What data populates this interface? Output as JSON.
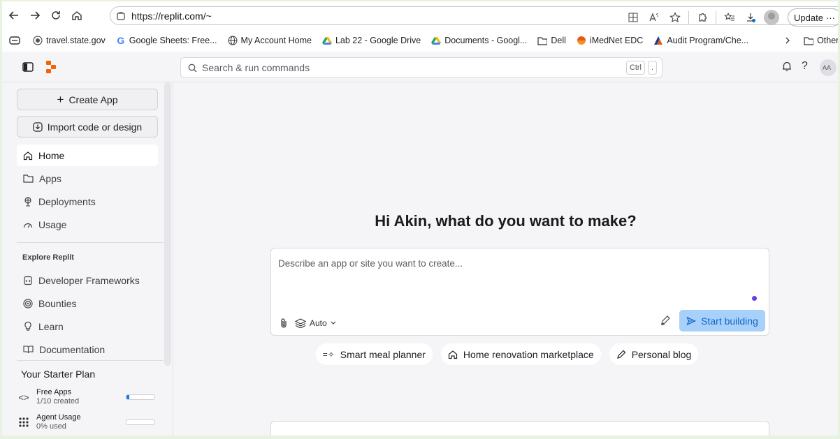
{
  "browser": {
    "url_prefix": "https://",
    "url_domain": "replit.com",
    "url_path": "/~",
    "update_label": "Update",
    "update_more": "···"
  },
  "bookmarks": [
    {
      "label": "travel.state.gov",
      "icon": "seal-icon"
    },
    {
      "label": "Google Sheets: Free...",
      "icon": "google-icon"
    },
    {
      "label": "My Account Home",
      "icon": "globe-icon"
    },
    {
      "label": "Lab 22 - Google Drive",
      "icon": "drive-icon"
    },
    {
      "label": "Documents - Googl...",
      "icon": "drive-icon"
    },
    {
      "label": "Dell",
      "icon": "folder-icon"
    },
    {
      "label": "iMedNet EDC",
      "icon": "imednet-icon"
    },
    {
      "label": "Audit Program/Che...",
      "icon": "audit-icon"
    }
  ],
  "bookmarks_other": "Other fa",
  "topbar": {
    "search_placeholder": "Search & run commands",
    "kbd1": "Ctrl",
    "kbd2": ".",
    "avatar": "AA"
  },
  "sidebar": {
    "create_app": "Create App",
    "import": "Import code or design",
    "nav": [
      {
        "label": "Home",
        "icon": "home-icon",
        "active": true
      },
      {
        "label": "Apps",
        "icon": "folder-icon",
        "active": false
      },
      {
        "label": "Deployments",
        "icon": "deploy-icon",
        "active": false
      },
      {
        "label": "Usage",
        "icon": "gauge-icon",
        "active": false
      }
    ],
    "explore_label": "Explore Replit",
    "explore": [
      {
        "label": "Developer Frameworks",
        "icon": "framework-icon"
      },
      {
        "label": "Bounties",
        "icon": "bounty-icon"
      },
      {
        "label": "Learn",
        "icon": "bulb-icon"
      },
      {
        "label": "Documentation",
        "icon": "book-icon"
      }
    ],
    "plan_label": "Your Starter Plan",
    "usage": [
      {
        "title": "Free Apps",
        "sub": "1/10 created",
        "fraction": 0.1
      },
      {
        "title": "Agent Usage",
        "sub": "0% used",
        "fraction": 0
      }
    ]
  },
  "main": {
    "greeting": "Hi Akin, what do you want to make?",
    "composer_placeholder": "Describe an app or site you want to create...",
    "mode": "Auto",
    "start_label": "Start building",
    "suggestions": [
      {
        "label": "Smart meal planner",
        "icon": "sparkle-icon"
      },
      {
        "label": "Home renovation marketplace",
        "icon": "home-icon"
      },
      {
        "label": "Personal blog",
        "icon": "pencil-icon"
      }
    ]
  },
  "colors": {
    "accent": "#0f7bf0",
    "start_bg": "#a7d1fb",
    "logo": "#f26207"
  }
}
